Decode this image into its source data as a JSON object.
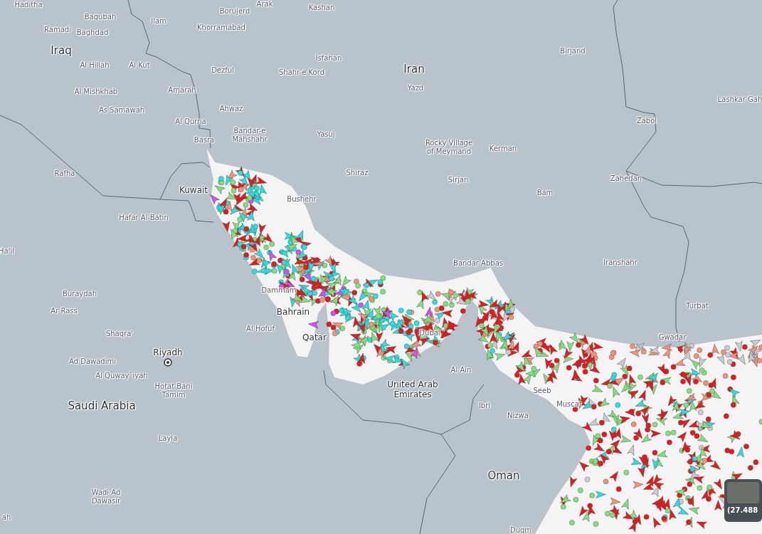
{
  "map": {
    "labels": [
      {
        "kind": "city",
        "text": "Haditha"
      },
      {
        "kind": "city",
        "text": "Arak"
      },
      {
        "kind": "city",
        "text": "Kashan"
      },
      {
        "kind": "city",
        "text": "Borujerd"
      },
      {
        "kind": "city",
        "text": "Baqubah"
      },
      {
        "kind": "city",
        "text": "Ilam"
      },
      {
        "kind": "city",
        "text": "Ramadi"
      },
      {
        "kind": "city",
        "text": "Baghdad"
      },
      {
        "kind": "city",
        "text": "Khorramabad"
      },
      {
        "kind": "country",
        "text": "Iraq"
      },
      {
        "kind": "city",
        "text": "Isfahan"
      },
      {
        "kind": "country",
        "text": "Iran"
      },
      {
        "kind": "city",
        "text": "Birjand"
      },
      {
        "kind": "city",
        "text": "Al Hillah"
      },
      {
        "kind": "city",
        "text": "Al Kut"
      },
      {
        "kind": "city",
        "text": "Dezful"
      },
      {
        "kind": "city",
        "text": "Shahr-e Kord"
      },
      {
        "kind": "city",
        "text": "Yazd"
      },
      {
        "kind": "city",
        "text": "Al Mishkhab"
      },
      {
        "kind": "city",
        "text": "Amarah"
      },
      {
        "kind": "city",
        "text": "Lashkar Gah"
      },
      {
        "kind": "city",
        "text": "As Samawah"
      },
      {
        "kind": "city",
        "text": "Ahwaz"
      },
      {
        "kind": "city",
        "text": "Zabol"
      },
      {
        "kind": "city",
        "text": "Al Qurna"
      },
      {
        "kind": "city",
        "text": "Bandar-e Mahshahr"
      },
      {
        "kind": "city",
        "text": "Yasuj"
      },
      {
        "kind": "city",
        "text": "Basra"
      },
      {
        "kind": "city",
        "text": "Rocky Village of Meymand"
      },
      {
        "kind": "city",
        "text": "Kerman"
      },
      {
        "kind": "city",
        "text": "Rafha"
      },
      {
        "kind": "city",
        "text": "Shiraz"
      },
      {
        "kind": "city",
        "text": "Sirjan"
      },
      {
        "kind": "city",
        "text": "Zahedan"
      },
      {
        "kind": "city",
        "text": "Bam"
      },
      {
        "kind": "major",
        "text": "Kuwait"
      },
      {
        "kind": "city",
        "text": "Bushehr"
      },
      {
        "kind": "city",
        "text": "Hafar Al-Batin"
      },
      {
        "kind": "city",
        "text": "Ha'il"
      },
      {
        "kind": "city",
        "text": "Bandar Abbas"
      },
      {
        "kind": "city",
        "text": "Iranshahr"
      },
      {
        "kind": "city",
        "text": "Dammam"
      },
      {
        "kind": "city",
        "text": "Buraydah"
      },
      {
        "kind": "major",
        "text": "Bahrain"
      },
      {
        "kind": "city",
        "text": "Turbat"
      },
      {
        "kind": "city",
        "text": "Ar Rass"
      },
      {
        "kind": "city",
        "text": "Al Hofuf"
      },
      {
        "kind": "city",
        "text": "Shaqra'"
      },
      {
        "kind": "major",
        "text": "Qatar"
      },
      {
        "kind": "city",
        "text": "Dubai"
      },
      {
        "kind": "city",
        "text": "Gwadar"
      },
      {
        "kind": "major",
        "text": "Riyadh"
      },
      {
        "kind": "city",
        "text": "Ad Dawadimi"
      },
      {
        "kind": "city",
        "text": "Al Ain"
      },
      {
        "kind": "city",
        "text": "Al Quway`iyah"
      },
      {
        "kind": "city",
        "text": "Hotat Bani Tamim"
      },
      {
        "kind": "major",
        "text": "United Arab Emirates"
      },
      {
        "kind": "city",
        "text": "Seeb"
      },
      {
        "kind": "country",
        "text": "Saudi Arabia"
      },
      {
        "kind": "city",
        "text": "Ibri"
      },
      {
        "kind": "city",
        "text": "Muscat"
      },
      {
        "kind": "city",
        "text": "Nizwa"
      },
      {
        "kind": "city",
        "text": "Layla"
      },
      {
        "kind": "country",
        "text": "Oman"
      },
      {
        "kind": "city",
        "text": "Wadi Ad Dawasir"
      },
      {
        "kind": "city",
        "text": "ah"
      },
      {
        "kind": "city",
        "text": "Duqm"
      }
    ]
  },
  "tooltip": {
    "text": "(27.488"
  }
}
